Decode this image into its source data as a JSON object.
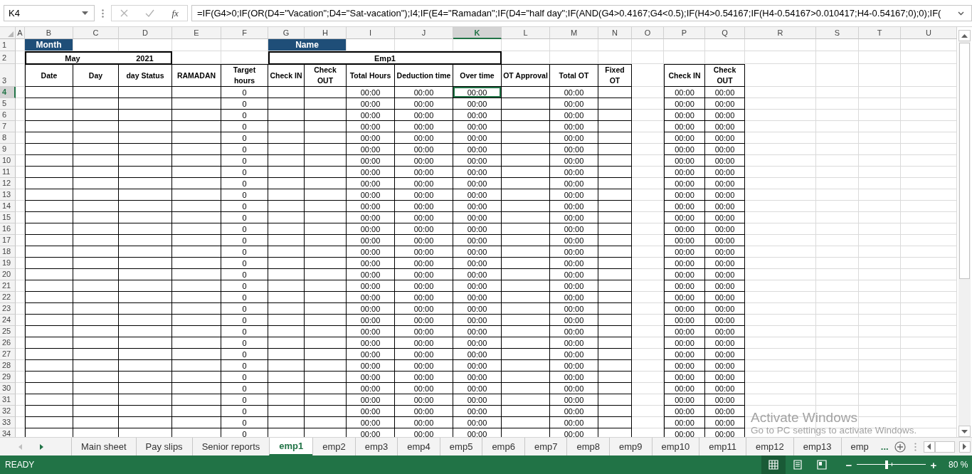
{
  "formula_bar": {
    "name_box": "K4",
    "fx": "fx",
    "formula": "=IF(G4>0;IF(OR(D4=\"Vacation\";D4=\"Sat-vacation\");I4;IF(E4=\"Ramadan\";IF(D4=\"half day\";IF(AND(G4>0.4167;G4<0.5);IF(H4>0.54167;IF(H4-0.54167>0.010417;H4-0.54167;0);0);IF("
  },
  "columns": [
    {
      "letter": "A",
      "selected": false
    },
    {
      "letter": "B",
      "selected": false
    },
    {
      "letter": "C",
      "selected": false
    },
    {
      "letter": "D",
      "selected": false
    },
    {
      "letter": "E",
      "selected": false
    },
    {
      "letter": "F",
      "selected": false
    },
    {
      "letter": "G",
      "selected": false
    },
    {
      "letter": "H",
      "selected": false
    },
    {
      "letter": "I",
      "selected": false
    },
    {
      "letter": "J",
      "selected": false
    },
    {
      "letter": "K",
      "selected": true
    },
    {
      "letter": "L",
      "selected": false
    },
    {
      "letter": "M",
      "selected": false
    },
    {
      "letter": "N",
      "selected": false
    },
    {
      "letter": "O",
      "selected": false
    },
    {
      "letter": "P",
      "selected": false
    },
    {
      "letter": "Q",
      "selected": false
    },
    {
      "letter": "R",
      "selected": false
    },
    {
      "letter": "S",
      "selected": false
    },
    {
      "letter": "T",
      "selected": false
    },
    {
      "letter": "U",
      "selected": false
    }
  ],
  "title_rows": {
    "month_label": "Month",
    "name_label": "Name",
    "month": "May",
    "year": "2021",
    "employee": "Emp1"
  },
  "headers": {
    "date": "Date",
    "day": "Day",
    "day_status": "day Status",
    "ramadan": "RAMADAN",
    "target_hours": "Target hours",
    "check_in": "Check IN",
    "check_out": "Check OUT",
    "total_hours": "Total Hours",
    "deduction_time": "Deduction time",
    "over_time": "Over time",
    "ot_approval": "OT Approval",
    "total_ot": "Total OT",
    "fixed_ot": "Fixed OT",
    "check_in_2": "Check IN",
    "check_out_2": "Check OUT"
  },
  "row_numbers": [
    {
      "n": "1",
      "selected": false
    },
    {
      "n": "2",
      "selected": false
    },
    {
      "n": "3",
      "selected": false
    }
  ],
  "rows": [
    {
      "n": "4",
      "selected": true,
      "target_hours": "0",
      "total_hours": "00:00",
      "deduction_time": "00:00",
      "over_time": "00:00",
      "total_ot": "00:00",
      "check_in_2": "00:00",
      "check_out_2": "00:00"
    },
    {
      "n": "5",
      "selected": false,
      "target_hours": "0",
      "total_hours": "00:00",
      "deduction_time": "00:00",
      "over_time": "00:00",
      "total_ot": "00:00",
      "check_in_2": "00:00",
      "check_out_2": "00:00"
    },
    {
      "n": "6",
      "selected": false,
      "target_hours": "0",
      "total_hours": "00:00",
      "deduction_time": "00:00",
      "over_time": "00:00",
      "total_ot": "00:00",
      "check_in_2": "00:00",
      "check_out_2": "00:00"
    },
    {
      "n": "7",
      "selected": false,
      "target_hours": "0",
      "total_hours": "00:00",
      "deduction_time": "00:00",
      "over_time": "00:00",
      "total_ot": "00:00",
      "check_in_2": "00:00",
      "check_out_2": "00:00"
    },
    {
      "n": "8",
      "selected": false,
      "target_hours": "0",
      "total_hours": "00:00",
      "deduction_time": "00:00",
      "over_time": "00:00",
      "total_ot": "00:00",
      "check_in_2": "00:00",
      "check_out_2": "00:00"
    },
    {
      "n": "9",
      "selected": false,
      "target_hours": "0",
      "total_hours": "00:00",
      "deduction_time": "00:00",
      "over_time": "00:00",
      "total_ot": "00:00",
      "check_in_2": "00:00",
      "check_out_2": "00:00"
    },
    {
      "n": "10",
      "selected": false,
      "target_hours": "0",
      "total_hours": "00:00",
      "deduction_time": "00:00",
      "over_time": "00:00",
      "total_ot": "00:00",
      "check_in_2": "00:00",
      "check_out_2": "00:00"
    },
    {
      "n": "11",
      "selected": false,
      "target_hours": "0",
      "total_hours": "00:00",
      "deduction_time": "00:00",
      "over_time": "00:00",
      "total_ot": "00:00",
      "check_in_2": "00:00",
      "check_out_2": "00:00"
    },
    {
      "n": "12",
      "selected": false,
      "target_hours": "0",
      "total_hours": "00:00",
      "deduction_time": "00:00",
      "over_time": "00:00",
      "total_ot": "00:00",
      "check_in_2": "00:00",
      "check_out_2": "00:00"
    },
    {
      "n": "13",
      "selected": false,
      "target_hours": "0",
      "total_hours": "00:00",
      "deduction_time": "00:00",
      "over_time": "00:00",
      "total_ot": "00:00",
      "check_in_2": "00:00",
      "check_out_2": "00:00"
    },
    {
      "n": "14",
      "selected": false,
      "target_hours": "0",
      "total_hours": "00:00",
      "deduction_time": "00:00",
      "over_time": "00:00",
      "total_ot": "00:00",
      "check_in_2": "00:00",
      "check_out_2": "00:00"
    },
    {
      "n": "15",
      "selected": false,
      "target_hours": "0",
      "total_hours": "00:00",
      "deduction_time": "00:00",
      "over_time": "00:00",
      "total_ot": "00:00",
      "check_in_2": "00:00",
      "check_out_2": "00:00"
    },
    {
      "n": "16",
      "selected": false,
      "target_hours": "0",
      "total_hours": "00:00",
      "deduction_time": "00:00",
      "over_time": "00:00",
      "total_ot": "00:00",
      "check_in_2": "00:00",
      "check_out_2": "00:00"
    },
    {
      "n": "17",
      "selected": false,
      "target_hours": "0",
      "total_hours": "00:00",
      "deduction_time": "00:00",
      "over_time": "00:00",
      "total_ot": "00:00",
      "check_in_2": "00:00",
      "check_out_2": "00:00"
    },
    {
      "n": "18",
      "selected": false,
      "target_hours": "0",
      "total_hours": "00:00",
      "deduction_time": "00:00",
      "over_time": "00:00",
      "total_ot": "00:00",
      "check_in_2": "00:00",
      "check_out_2": "00:00"
    },
    {
      "n": "19",
      "selected": false,
      "target_hours": "0",
      "total_hours": "00:00",
      "deduction_time": "00:00",
      "over_time": "00:00",
      "total_ot": "00:00",
      "check_in_2": "00:00",
      "check_out_2": "00:00"
    },
    {
      "n": "20",
      "selected": false,
      "target_hours": "0",
      "total_hours": "00:00",
      "deduction_time": "00:00",
      "over_time": "00:00",
      "total_ot": "00:00",
      "check_in_2": "00:00",
      "check_out_2": "00:00"
    },
    {
      "n": "21",
      "selected": false,
      "target_hours": "0",
      "total_hours": "00:00",
      "deduction_time": "00:00",
      "over_time": "00:00",
      "total_ot": "00:00",
      "check_in_2": "00:00",
      "check_out_2": "00:00"
    },
    {
      "n": "22",
      "selected": false,
      "target_hours": "0",
      "total_hours": "00:00",
      "deduction_time": "00:00",
      "over_time": "00:00",
      "total_ot": "00:00",
      "check_in_2": "00:00",
      "check_out_2": "00:00"
    },
    {
      "n": "23",
      "selected": false,
      "target_hours": "0",
      "total_hours": "00:00",
      "deduction_time": "00:00",
      "over_time": "00:00",
      "total_ot": "00:00",
      "check_in_2": "00:00",
      "check_out_2": "00:00"
    },
    {
      "n": "24",
      "selected": false,
      "target_hours": "0",
      "total_hours": "00:00",
      "deduction_time": "00:00",
      "over_time": "00:00",
      "total_ot": "00:00",
      "check_in_2": "00:00",
      "check_out_2": "00:00"
    },
    {
      "n": "25",
      "selected": false,
      "target_hours": "0",
      "total_hours": "00:00",
      "deduction_time": "00:00",
      "over_time": "00:00",
      "total_ot": "00:00",
      "check_in_2": "00:00",
      "check_out_2": "00:00"
    },
    {
      "n": "26",
      "selected": false,
      "target_hours": "0",
      "total_hours": "00:00",
      "deduction_time": "00:00",
      "over_time": "00:00",
      "total_ot": "00:00",
      "check_in_2": "00:00",
      "check_out_2": "00:00"
    },
    {
      "n": "27",
      "selected": false,
      "target_hours": "0",
      "total_hours": "00:00",
      "deduction_time": "00:00",
      "over_time": "00:00",
      "total_ot": "00:00",
      "check_in_2": "00:00",
      "check_out_2": "00:00"
    },
    {
      "n": "28",
      "selected": false,
      "target_hours": "0",
      "total_hours": "00:00",
      "deduction_time": "00:00",
      "over_time": "00:00",
      "total_ot": "00:00",
      "check_in_2": "00:00",
      "check_out_2": "00:00"
    },
    {
      "n": "29",
      "selected": false,
      "target_hours": "0",
      "total_hours": "00:00",
      "deduction_time": "00:00",
      "over_time": "00:00",
      "total_ot": "00:00",
      "check_in_2": "00:00",
      "check_out_2": "00:00"
    },
    {
      "n": "30",
      "selected": false,
      "target_hours": "0",
      "total_hours": "00:00",
      "deduction_time": "00:00",
      "over_time": "00:00",
      "total_ot": "00:00",
      "check_in_2": "00:00",
      "check_out_2": "00:00"
    },
    {
      "n": "31",
      "selected": false,
      "target_hours": "0",
      "total_hours": "00:00",
      "deduction_time": "00:00",
      "over_time": "00:00",
      "total_ot": "00:00",
      "check_in_2": "00:00",
      "check_out_2": "00:00"
    },
    {
      "n": "32",
      "selected": false,
      "target_hours": "0",
      "total_hours": "00:00",
      "deduction_time": "00:00",
      "over_time": "00:00",
      "total_ot": "00:00",
      "check_in_2": "00:00",
      "check_out_2": "00:00"
    },
    {
      "n": "33",
      "selected": false,
      "target_hours": "0",
      "total_hours": "00:00",
      "deduction_time": "00:00",
      "over_time": "00:00",
      "total_ot": "00:00",
      "check_in_2": "00:00",
      "check_out_2": "00:00"
    },
    {
      "n": "34",
      "selected": false,
      "target_hours": "0",
      "total_hours": "00:00",
      "deduction_time": "00:00",
      "over_time": "00:00",
      "total_ot": "00:00",
      "check_in_2": "00:00",
      "check_out_2": "00:00"
    }
  ],
  "sheet_tabs": [
    {
      "label": "Main sheet",
      "selected": false
    },
    {
      "label": "Pay slips",
      "selected": false
    },
    {
      "label": "Senior reports",
      "selected": false
    },
    {
      "label": "emp1",
      "selected": true
    },
    {
      "label": "emp2",
      "selected": false
    },
    {
      "label": "emp3",
      "selected": false
    },
    {
      "label": "emp4",
      "selected": false
    },
    {
      "label": "emp5",
      "selected": false
    },
    {
      "label": "emp6",
      "selected": false
    },
    {
      "label": "emp7",
      "selected": false
    },
    {
      "label": "emp8",
      "selected": false
    },
    {
      "label": "emp9",
      "selected": false
    },
    {
      "label": "emp10",
      "selected": false
    },
    {
      "label": "emp11",
      "selected": false
    },
    {
      "label": "emp12",
      "selected": false
    },
    {
      "label": "emp13",
      "selected": false
    },
    {
      "label": "emp",
      "selected": false
    }
  ],
  "more_tabs": "...",
  "status_bar": {
    "mode": "READY",
    "views": [
      {
        "kind": "normal",
        "selected": true
      },
      {
        "kind": "page_layout",
        "selected": false
      },
      {
        "kind": "page_break",
        "selected": false
      }
    ],
    "zoom": {
      "minus": "−",
      "plus": "+",
      "level": 0.43,
      "reading": "80 %"
    }
  },
  "activation_notice": {
    "title": "Activate Windows",
    "message": "Go to PC settings to activate Windows."
  }
}
